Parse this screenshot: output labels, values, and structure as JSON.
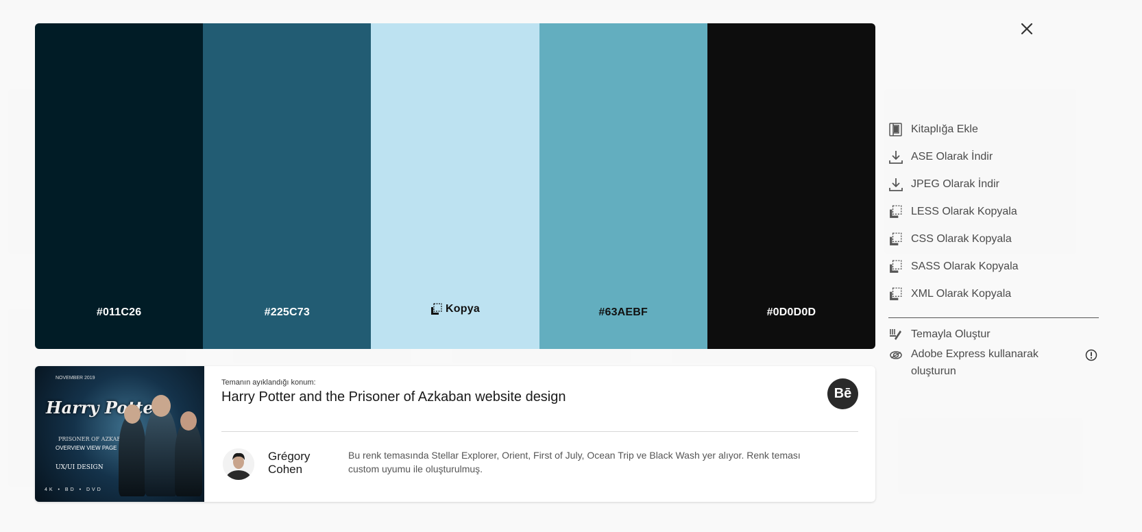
{
  "close_label": "×",
  "palette": {
    "swatches": [
      {
        "color": "#011C26",
        "label": "#011C26",
        "text_color": "#ffffff"
      },
      {
        "color": "#225C73",
        "label": "#225C73",
        "text_color": "#ffffff"
      },
      {
        "color": "#BDE2F1",
        "label": "Kopya",
        "text_color": "#111111",
        "hover": true
      },
      {
        "color": "#63AEBF",
        "label": "#63AEBF",
        "text_color": "#111111"
      },
      {
        "color": "#0D0D0D",
        "label": "#0D0D0D",
        "text_color": "#ffffff"
      }
    ]
  },
  "card": {
    "source_label": "Temanın ayıklandığı konum:",
    "title": "Harry Potter and the Prisoner of Azkaban website design",
    "behance_label": "Bē",
    "author": "Grégory Cohen",
    "description": "Bu renk temasında Stellar Explorer, Orient, First of July, Ocean Trip ve Black Wash yer alıyor. Renk teması custom uyumu ile oluşturulmuş.",
    "thumbnail": {
      "top_text": "NOVEMBER 2019",
      "title_line1": "Harry Potter",
      "subtitle": "PRISONER OF AZKABAN",
      "tagline": "OVERVIEW VIEW PAGE",
      "design_label": "UX/UI DESIGN",
      "logos": "4K • BD • DVD"
    }
  },
  "actions": {
    "items": [
      {
        "label": "Kitaplığa Ekle",
        "icon": "library-icon"
      },
      {
        "label": "ASE Olarak İndir",
        "icon": "download-icon"
      },
      {
        "label": "JPEG Olarak İndir",
        "icon": "download-icon"
      },
      {
        "label": "LESS Olarak Kopyala",
        "icon": "copy-icon"
      },
      {
        "label": "CSS Olarak Kopyala",
        "icon": "copy-icon"
      },
      {
        "label": "SASS Olarak Kopyala",
        "icon": "copy-icon"
      },
      {
        "label": "XML Olarak Kopyala",
        "icon": "copy-icon"
      }
    ],
    "create_theme": "Temayla Oluştur",
    "adobe_express": "Adobe Express kullanarak oluşturun"
  }
}
